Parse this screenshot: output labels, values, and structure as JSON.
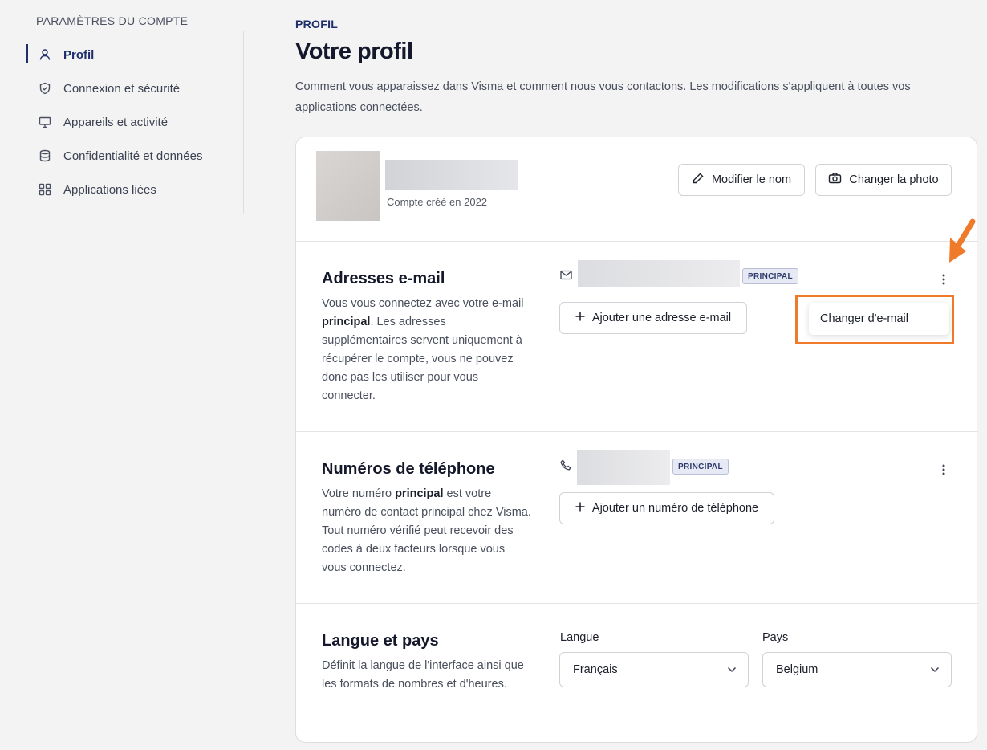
{
  "sidebar": {
    "title": "PARAMÈTRES DU COMPTE",
    "items": [
      {
        "label": "Profil"
      },
      {
        "label": "Connexion et sécurité"
      },
      {
        "label": "Appareils et activité"
      },
      {
        "label": "Confidentialité et données"
      },
      {
        "label": "Applications liées"
      }
    ]
  },
  "header": {
    "breadcrumb": "PROFIL",
    "title": "Votre profil",
    "description": "Comment vous apparaissez dans Visma et comment nous vous contactons. Les modifications s'appliquent à toutes vos applications connectées."
  },
  "profile": {
    "created": "Compte créé en 2022",
    "edit_name_label": "Modifier le nom",
    "change_photo_label": "Changer la photo"
  },
  "email": {
    "title": "Adresses e-mail",
    "desc_before": "Vous vous connectez avec votre e-mail ",
    "desc_bold": "principal",
    "desc_after": ". Les adresses supplémentaires servent uniquement à récupérer le compte, vous ne pouvez donc pas les utiliser pour vous connecter.",
    "badge": "PRINCIPAL",
    "add_label": "Ajouter une adresse e-mail",
    "menu_item": "Changer d'e-mail"
  },
  "phone": {
    "title": "Numéros de téléphone",
    "desc_before": "Votre numéro ",
    "desc_bold": "principal",
    "desc_after": " est votre numéro de contact principal chez Visma. Tout numéro vérifié peut recevoir des codes à deux facteurs lorsque vous vous connectez.",
    "badge": "PRINCIPAL",
    "add_label": "Ajouter un numéro de téléphone"
  },
  "locale": {
    "title": "Langue et pays",
    "desc": "Définit la langue de l'interface ainsi que les formats de nombres et d'heures.",
    "language_label": "Langue",
    "language_value": "Français",
    "country_label": "Pays",
    "country_value": "Belgium"
  },
  "colors": {
    "accent": "#1f2f6b",
    "highlight": "#ef7b2a"
  }
}
